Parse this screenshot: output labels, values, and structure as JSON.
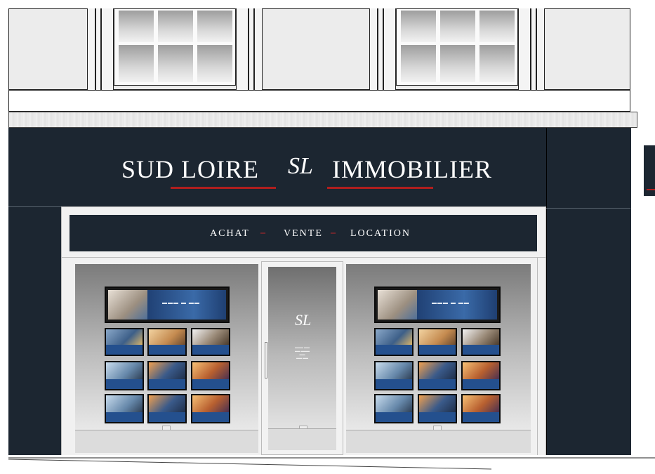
{
  "sign": {
    "left_word": "SUD LOIRE",
    "right_word": "IMMOBILIER",
    "monogram": "SL"
  },
  "services": {
    "achat": "ACHAT",
    "sep1": "–",
    "vente": "VENTE",
    "sep2": "–",
    "location": "LOCATION"
  },
  "door": {
    "monogram": "SL"
  },
  "colors": {
    "dark_panel": "#1c2631",
    "accent_red": "#b01e1e",
    "listing_blue": "#24508e"
  }
}
